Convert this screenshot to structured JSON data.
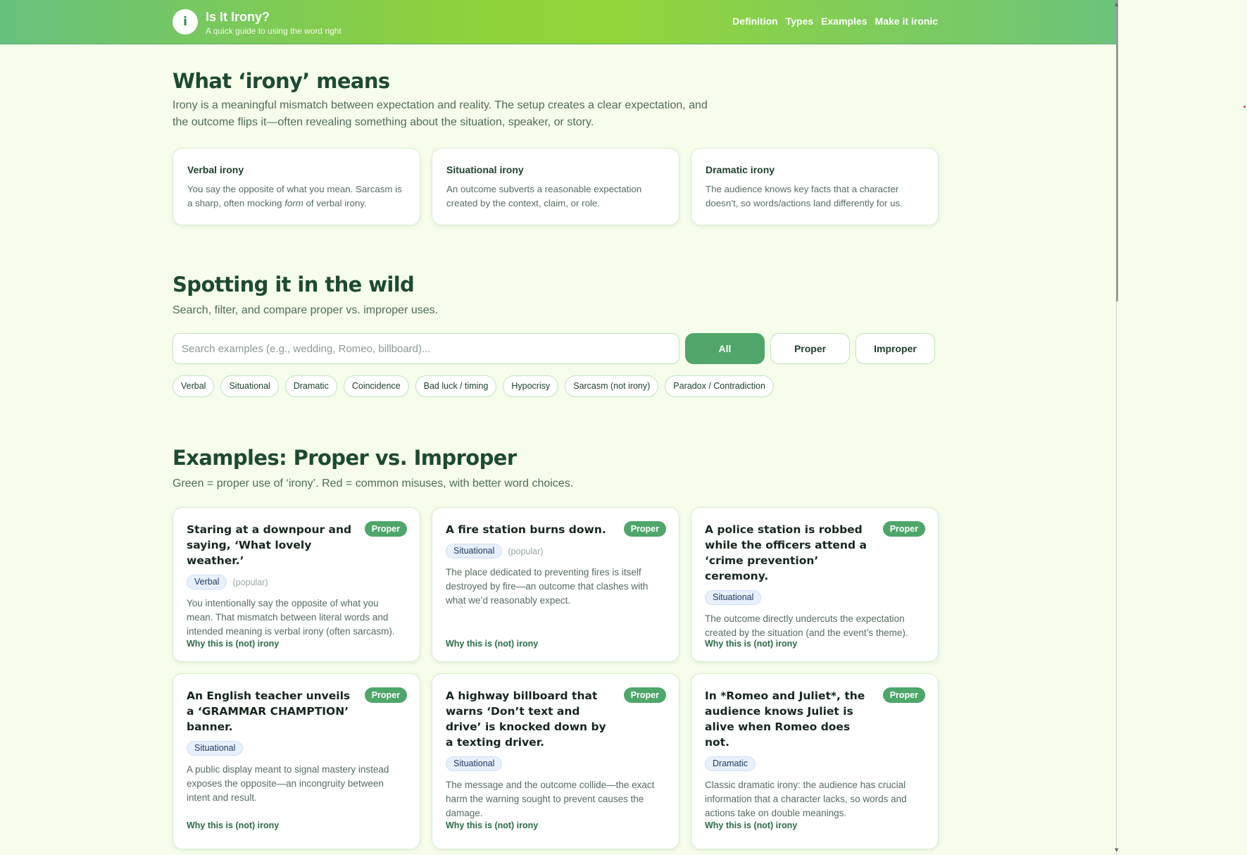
{
  "header": {
    "logo_glyph": "i",
    "title": "Is It Irony?",
    "subtitle": "A quick guide to using the word right",
    "nav": [
      {
        "label": "Definition"
      },
      {
        "label": "Types"
      },
      {
        "label": "Examples"
      },
      {
        "label": "Make it ironic"
      }
    ]
  },
  "definition": {
    "heading": "What ‘irony’ means",
    "lead": "Irony is a meaningful mismatch between expectation and reality. The setup creates a clear expectation, and the outcome flips it—often revealing something about the situation, speaker, or story.",
    "types": [
      {
        "title": "Verbal irony",
        "text_before": "You say the opposite of what you mean. Sarcasm is a sharp, often mocking ",
        "text_em": "form",
        "text_after": " of verbal irony."
      },
      {
        "title": "Situational irony",
        "text": "An outcome subverts a reasonable expectation created by the context, claim, or role."
      },
      {
        "title": "Dramatic irony",
        "text": "The audience knows key facts that a character doesn’t, so words/actions land differently for us."
      }
    ]
  },
  "spotting": {
    "heading": "Spotting it in the wild",
    "lead": "Search, filter, and compare proper vs. improper uses.",
    "search_placeholder": "Search examples (e.g., wedding, Romeo, billboard)...",
    "search_value": "",
    "filters": [
      {
        "label": "All",
        "active": true
      },
      {
        "label": "Proper",
        "active": false
      },
      {
        "label": "Improper",
        "active": false
      }
    ],
    "chips": [
      "Verbal",
      "Situational",
      "Dramatic",
      "Coincidence",
      "Bad luck / timing",
      "Hypocrisy",
      "Sarcasm (not irony)",
      "Paradox / Contradiction"
    ]
  },
  "examples": {
    "heading": "Examples: Proper vs. Improper",
    "lead": "Green = proper use of ‘irony’. Red = common misuses, with better word choices.",
    "why_label": "Why this is (not) irony",
    "cards": [
      {
        "title": "Staring at a downpour and saying, ‘What lovely weather.’",
        "badge": "Proper",
        "tag": "Verbal",
        "popular": "(popular)",
        "desc": "You intentionally say the opposite of what you mean. That mismatch between literal words and intended meaning is verbal irony (often sarcasm)."
      },
      {
        "title": "A fire station burns down.",
        "badge": "Proper",
        "tag": "Situational",
        "popular": "(popular)",
        "desc": "The place dedicated to preventing fires is itself destroyed by fire—an outcome that clashes with what we’d reasonably expect."
      },
      {
        "title": "A police station is robbed while the officers attend a ‘crime prevention’ ceremony.",
        "badge": "Proper",
        "tag": "Situational",
        "popular": "",
        "desc": "The outcome directly undercuts the expectation created by the situation (and the event’s theme)."
      },
      {
        "title": "An English teacher unveils a ‘GRAMMAR CHAMPTION’ banner.",
        "badge": "Proper",
        "tag": "Situational",
        "popular": "",
        "desc": "A public display meant to signal mastery instead exposes the opposite—an incongruity between intent and result."
      },
      {
        "title": "A highway billboard that warns ‘Don’t text and drive’ is knocked down by a texting driver.",
        "badge": "Proper",
        "tag": "Situational",
        "popular": "",
        "desc": "The message and the outcome collide—the exact harm the warning sought to prevent causes the damage."
      },
      {
        "title": "In *Romeo and Juliet*, the audience knows Juliet is alive when Romeo does not.",
        "badge": "Proper",
        "tag": "Dramatic",
        "popular": "",
        "desc": "Classic dramatic irony: the audience has crucial information that a character lacks, so words and actions take on double meanings."
      }
    ]
  }
}
